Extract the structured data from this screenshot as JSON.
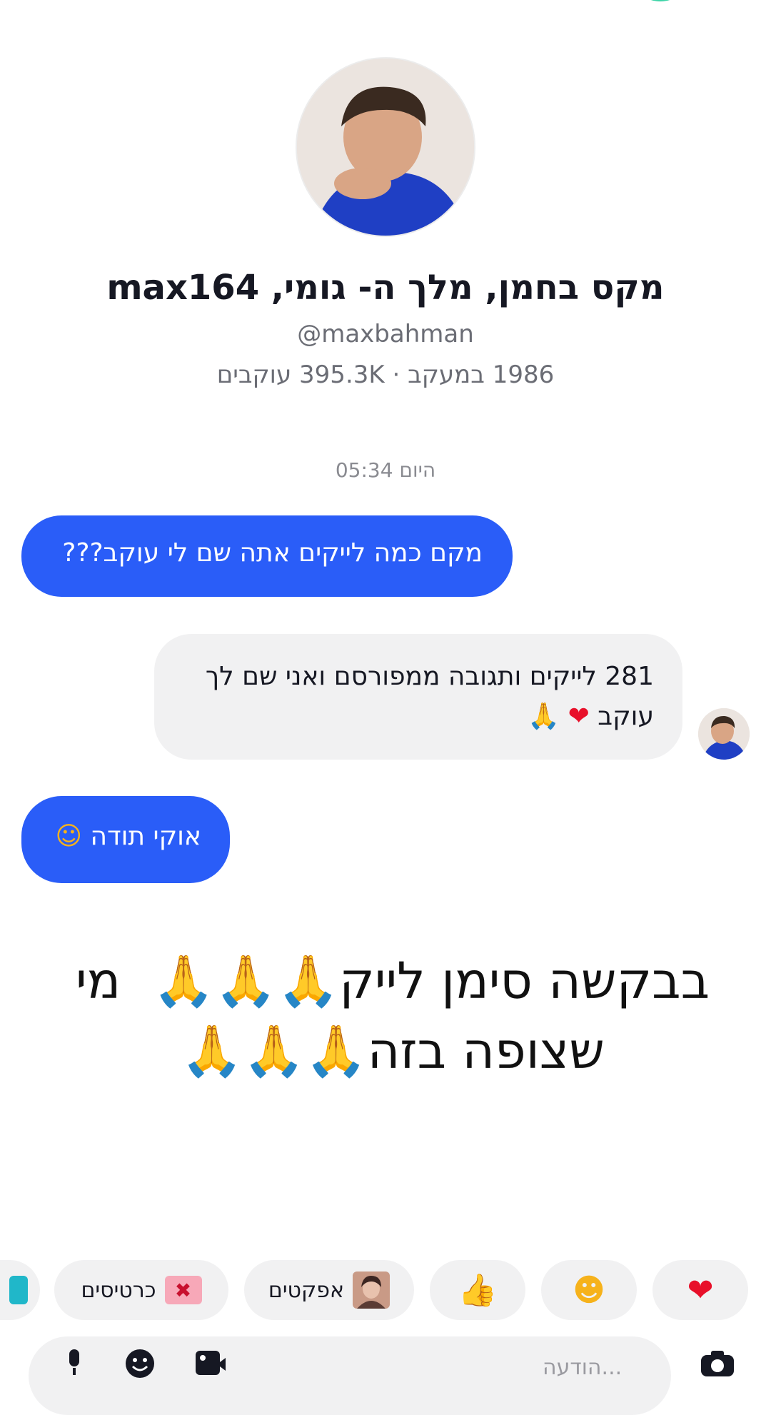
{
  "profile": {
    "name": "מקס בחמן, מלך ה- גומי, max164",
    "handle": "@maxbahman",
    "stats": "1986 במעקב · 395.3K עוקבים"
  },
  "chat": {
    "timestamp": "היום 05:34",
    "messages": [
      {
        "side": "sent",
        "text": "מקם כמה לייקים אתה שם לי עוקב???"
      },
      {
        "side": "received",
        "line1": "281 לייקים ותגובה ממפורסם ואני שם לך",
        "line2_text": "עוקב",
        "line2_icons": [
          "heart-icon",
          "pray-icon"
        ]
      },
      {
        "side": "sent",
        "text": "אוקי תודה",
        "icon": "hug-emoji"
      }
    ]
  },
  "caption": {
    "line1": "בבקשה סימן לייק",
    "line1_end": "מי",
    "line2": "שצופה בזה"
  },
  "quick_replies": {
    "heart": "heart-icon",
    "laugh": "laugh-cry-emoji",
    "thumb": "thumbs-up-emoji",
    "effects_label": "אפקטים",
    "cards_label": "כרטיסים"
  },
  "input": {
    "placeholder": "הודעה..."
  },
  "colors": {
    "sent_bubble": "#2a5df8",
    "received_bubble": "#f1f1f2",
    "accent_ring": "#3fd4a8"
  }
}
